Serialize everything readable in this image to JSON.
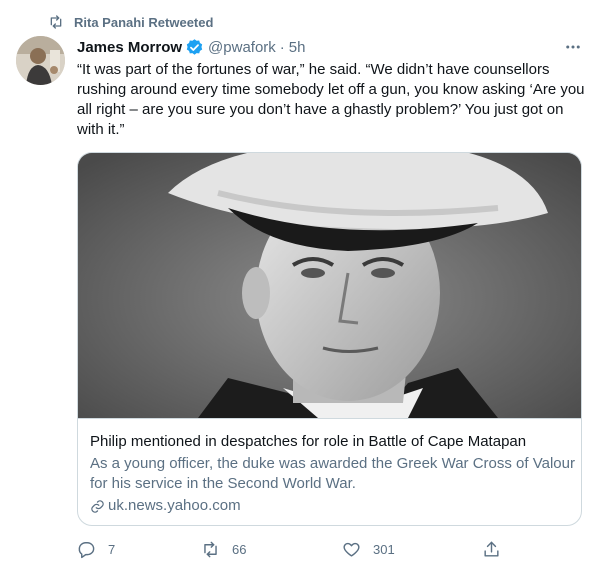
{
  "retweet": {
    "icon": "retweet-icon",
    "text": "Rita Panahi Retweeted"
  },
  "author": {
    "avatar": "avatar-photo",
    "name": "James Morrow",
    "verified_icon": "verified-badge-icon",
    "handle": "@pwafork",
    "dot": "·",
    "time": "5h"
  },
  "more_icon": "more-horizontal-icon",
  "tweet": {
    "text": "“It was part of the fortunes of war,” he said. “We didn’t have counsellors rushing around every time somebody let off a gun, you know asking ‘Are you all right – are you sure you don’t have a ghastly problem?’ You just got on with it.”"
  },
  "card": {
    "image": "black-and-white-portrait-photo",
    "title": "Philip mentioned in despatches for role in Battle of Cape Matapan",
    "description": "As a young officer, the duke was awarded the Greek War Cross of Valour for his service in the Second World War.",
    "link_icon": "link-icon",
    "domain": "uk.news.yahoo.com"
  },
  "actions": {
    "reply": {
      "icon": "reply-icon",
      "count": "7"
    },
    "retweet": {
      "icon": "retweet-icon",
      "count": "66"
    },
    "like": {
      "icon": "heart-icon",
      "count": "301"
    },
    "share": {
      "icon": "share-icon"
    }
  },
  "colors": {
    "text_primary": "#0f1419",
    "text_secondary": "#5b7083",
    "verified": "#1da1f2",
    "border": "#cfd9de"
  }
}
